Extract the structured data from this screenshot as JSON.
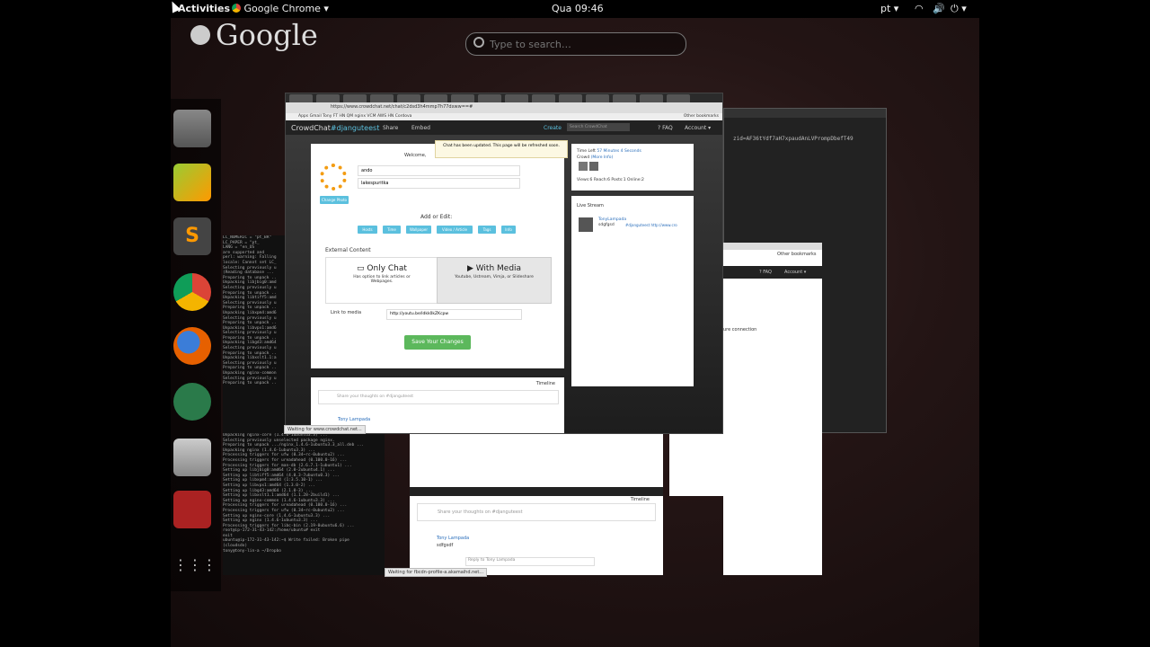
{
  "topbar": {
    "activities": "Activities",
    "app_menu": "Google Chrome",
    "clock": "Qua 09:46",
    "lang": "pt"
  },
  "overview": {
    "brand": "Google",
    "search_placeholder": "Type to search…"
  },
  "dock": [
    "trash",
    "pycharm",
    "sublime-text",
    "chrome",
    "firefox",
    "atom",
    "files",
    "screen-recorder",
    "show-apps"
  ],
  "browser": {
    "url": "https://www.crowdchat.net/chat/c2dsd3h4mmp7h77dxww==#",
    "bookmarks": "Apps  Gmail  Tony  FT  HN  QM  nginx  VCM  AWS  HN  Cordova",
    "other_bookmarks": "Other bookmarks",
    "brand": "CrowdChat",
    "hashtag": "#djanguteest",
    "share": "Share",
    "embed": "Embed",
    "create": "Create",
    "search_ph": "Search CrowdChat",
    "faq": "FAQ",
    "account": "Account",
    "alert": "Chat has been updated. This page will be refreshed soon.",
    "welcome": "Welcome,",
    "field1": "ando",
    "field2": "lakespuritka",
    "change_photo": "Change Photo",
    "add_or_edit": "Add or Edit:",
    "tag_buttons": [
      "Hosts",
      "Time",
      "Wallpaper",
      "Video / Article",
      "Tags",
      "Info"
    ],
    "external_content": "External Content",
    "only_chat": "Only Chat",
    "only_chat_desc": "Has option to link articles or Webpages.",
    "with_media": "With Media",
    "with_media_desc": "Youtube, Ustream, Vimja, or Slideshare",
    "link_to_media": "Link to media",
    "media_url": "http://youtu.be/ldkk0kZKcpw",
    "save": "Save Your Changes",
    "time_left_label": "Time Left",
    "time_left": "57 Minutes 4 Seconds",
    "crowd": "Crowd",
    "more_info": "(More Info)",
    "stats": "Views:6  Reach:6  Posts:1  Online:2",
    "live_stream": "Live Stream",
    "stream_user": "TonyLampada",
    "stream_user2": "Tony Lampada",
    "stream_msg": "sdgfgsd",
    "stream_link": "#djanguteest  http://www.cro",
    "timeline": "Timeline",
    "share_thoughts": "Share your thoughts on #djanguteest",
    "post_user": "Tony Lampada",
    "post_text": "sdfgsdf",
    "reply": "Reply to Tony Lampada",
    "status1": "Waiting for www.crowdchat.net...",
    "status2": "Waiting for fbcdn-profile-a.akamaihd.net..."
  },
  "terminal_lines": [
    "LC_NUMERIC = \"pt_BR\"",
    "LC_PAPER = \"pt_",
    "LANG = \"en_US",
    "are supported and",
    "perl: warning: Falling",
    "locale: Cannot set LC_",
    "Selecting previously u",
    "(Reading database ...",
    "Preparing to unpack ..",
    "Unpacking libjbig0:amd",
    "Selecting previously u",
    "Preparing to unpack ..",
    "Unpacking libtiff5:amd",
    "Selecting previously u",
    "Preparing to unpack ..",
    "Unpacking libxpm4:amd6",
    "Selecting previously u",
    "Preparing to unpack ..",
    "Unpacking libvpx1:amd6",
    "Selecting previously u",
    "Preparing to unpack ..",
    "Unpacking libgd3:amd64",
    "Selecting previously u",
    "Preparing to unpack ..",
    "Unpacking libxslt1.1:a",
    "Selecting previously u",
    "Preparing to unpack ..",
    "Unpacking nginx-common",
    "Selecting previously u",
    "Preparing to unpack ..",
    "Unpacking nginx-core (1.4.6-1ubuntu3.3) ...",
    "Selecting previously unselected package nginx.",
    "Preparing to unpack .../nginx_1.4.6-1ubuntu3.3_all.deb ...",
    "Unpacking nginx (1.4.6-1ubuntu3.3) ...",
    "Processing triggers for ufw (0.34~rc-0ubuntu2) ...",
    "Processing triggers for ureadahead (0.100.0-16) ...",
    "Processing triggers for man-db (2.6.7.1-1ubuntu1) ...",
    "Setting up libjbig0:amd64 (2.0-2ubuntu4.1) ...",
    "Setting up libtiff5:amd64 (4.0.3-7ubuntu0.3) ...",
    "Setting up libxpm4:amd64 (1:3.5.10-1) ...",
    "Setting up libvpx1:amd64 (1.3.0-2) ...",
    "Setting up libgd3:amd64 (2.1.0-3) ...",
    "Setting up libxslt1.1:amd64 (1.1.28-2build1) ...",
    "Setting up nginx-common (1.4.6-1ubuntu3.3) ...",
    "Processing triggers for ureadahead (0.100.0-16) ...",
    "Processing triggers for ufw (0.34~rc-0ubuntu2) ...",
    "Setting up nginx-core (1.4.6-1ubuntu3.3) ...",
    "Setting up nginx (1.4.6-1ubuntu3.3) ...",
    "Processing triggers for libc-bin (2.19-0ubuntu6.6) ...",
    "root@ip-172-31-43-142:/home/ubuntu# exit",
    "exit",
    "ubuntu@ip-172-31-43-142:~$ Write failed: Broken pipe",
    "(cloudsdo)",
    "tony@tony-lin-a ~/Dropbo"
  ],
  "right_window": {
    "hash": "zid=AF36tYdf7aH7xpaudAnLVPrompDbefT49",
    "other_bookmarks": "Other bookmarks",
    "faq": "FAQ",
    "account": "Account",
    "secure": "ure connection"
  }
}
